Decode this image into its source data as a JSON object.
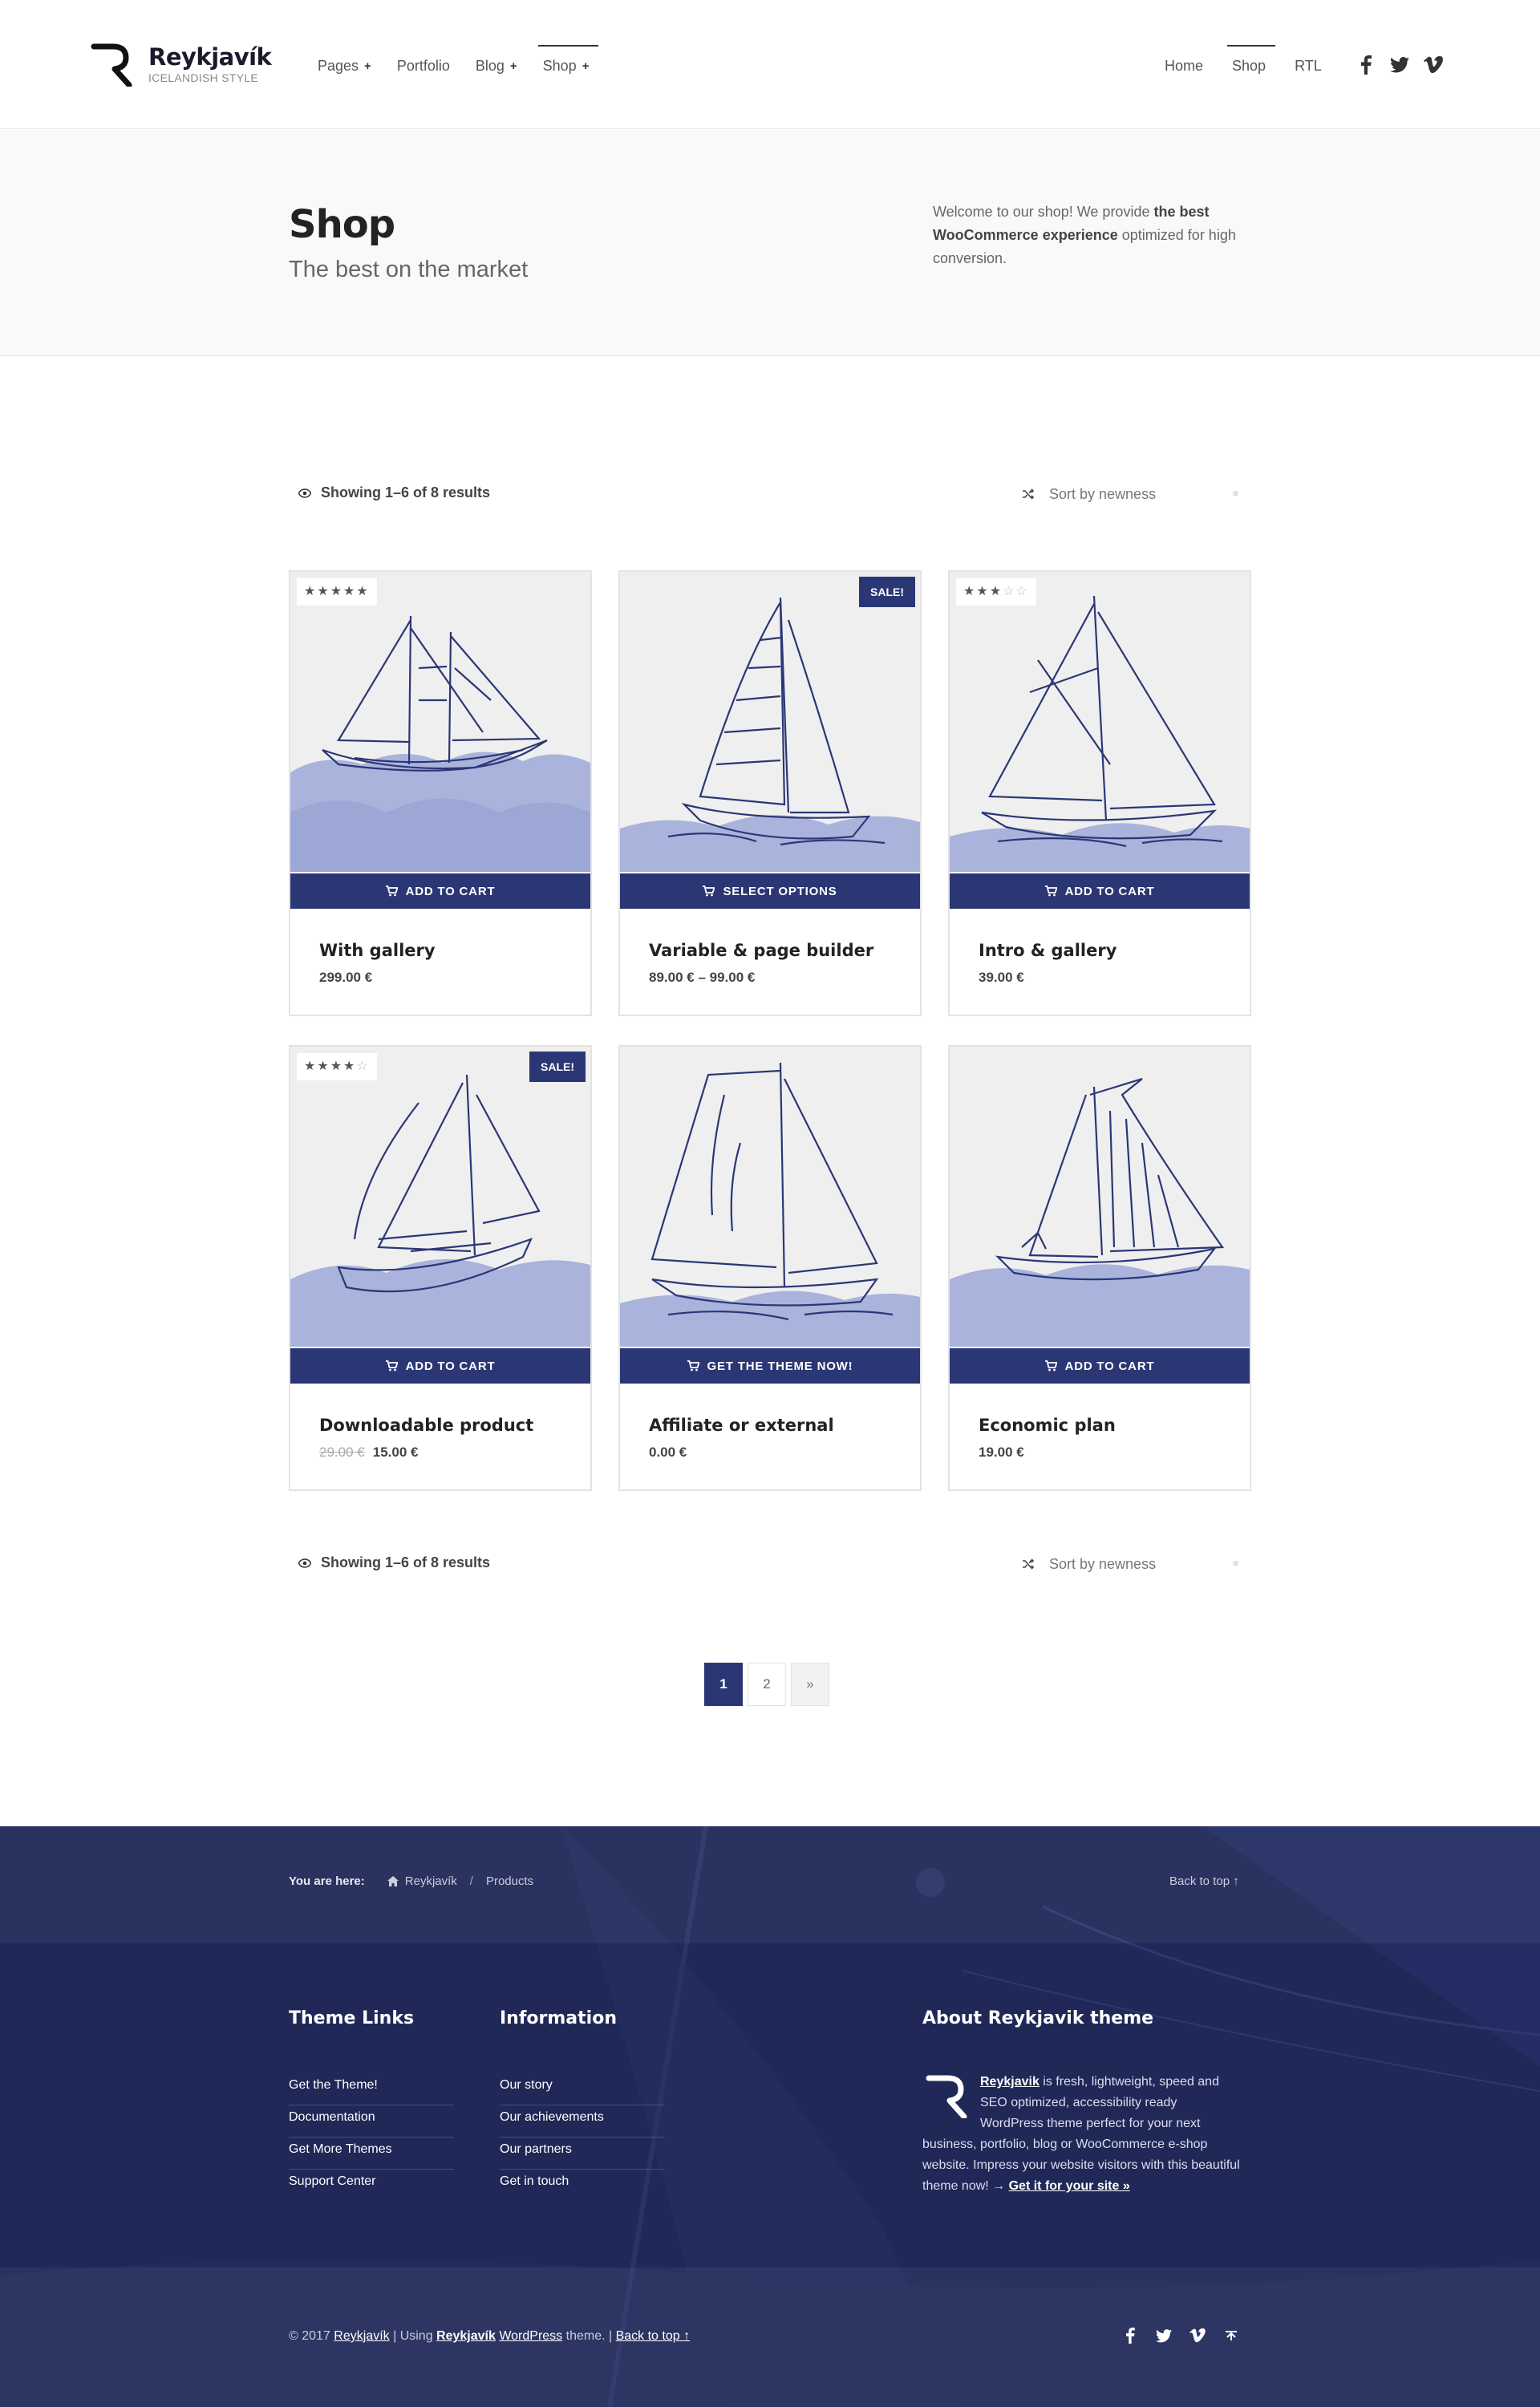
{
  "brand": {
    "name": "Reykjavík",
    "tagline": "ICELANDISH STYLE"
  },
  "nav_main": [
    {
      "label": "Pages",
      "plus": "+"
    },
    {
      "label": "Portfolio"
    },
    {
      "label": "Blog",
      "plus": "+"
    },
    {
      "label": "Shop",
      "plus": "+"
    }
  ],
  "nav_secondary": [
    {
      "label": "Home"
    },
    {
      "label": "Shop"
    },
    {
      "label": "RTL"
    }
  ],
  "social_icons": [
    "facebook-icon",
    "twitter-icon",
    "vimeo-icon"
  ],
  "hero": {
    "title": "Shop",
    "subtitle": "The best on the market",
    "desc_pre": "Welcome to our shop! We provide ",
    "desc_bold": "the best WooCommerce experience",
    "desc_post": " optimized for high conversion."
  },
  "toolbar": {
    "results": "Showing 1–6 of 8 results",
    "sort": "Sort by newness",
    "caret": "≡"
  },
  "products": [
    {
      "name": "With gallery",
      "price": "299.00 €",
      "rating": "★★★★★",
      "rating_off": "",
      "button": "Add to cart",
      "sale": ""
    },
    {
      "name": "Variable & page builder",
      "price": "89.00 € – 99.00 €",
      "rating": "",
      "rating_off": "",
      "button": "Select options",
      "sale": "SALE!"
    },
    {
      "name": "Intro & gallery",
      "price": "39.00 €",
      "rating": "★★★",
      "rating_off": "☆☆",
      "button": "Add to cart",
      "sale": ""
    },
    {
      "name": "Downloadable product",
      "old_price": "29.00 €",
      "price": "15.00 €",
      "rating": "★★★★",
      "rating_off": "☆",
      "button": "Add to cart",
      "sale": "SALE!"
    },
    {
      "name": "Affiliate or external",
      "price": "0.00 €",
      "rating": "",
      "rating_off": "",
      "button": "Get the theme now!",
      "sale": ""
    },
    {
      "name": "Economic plan",
      "price": "19.00 €",
      "rating": "",
      "rating_off": "",
      "button": "Add to cart",
      "sale": ""
    }
  ],
  "pagination": {
    "pages": [
      "1",
      "2"
    ],
    "next": "»",
    "current": "1"
  },
  "footer": {
    "breadcrumb_label": "You are here:",
    "breadcrumb_home": "Reykjavík",
    "breadcrumb_sep": "/",
    "breadcrumb_current": "Products",
    "back_to_top": "Back to top ↑",
    "theme_links": {
      "title": "Theme Links",
      "items": [
        "Get the Theme!",
        "Documentation",
        "Get More Themes",
        "Support Center"
      ]
    },
    "information": {
      "title": "Information",
      "items": [
        "Our story",
        "Our achievements",
        "Our partners",
        "Get in touch"
      ]
    },
    "about": {
      "title": "About Reykjavik theme",
      "brand": "Reykjavik",
      "text": " is fresh, lightweight, speed and SEO optimized, accessibility ready WordPress theme perfect for your next business, portfolio, blog or WooCommerce e-shop website. Impress your website visitors with this beautiful theme now! → ",
      "link": "Get it for your site »"
    },
    "copyright": {
      "pre": "© 2017 ",
      "site": "Reykjavík",
      "mid": " | Using ",
      "theme": "Reykjavík",
      "sp": " ",
      "wp": "WordPress",
      "post": " theme. | ",
      "top": "Back to top ↑"
    }
  },
  "colors": {
    "accent": "#2b3775",
    "footer_bg": "#1f2857",
    "image_bg": "#efefef",
    "wave": "#a9b3dc"
  }
}
